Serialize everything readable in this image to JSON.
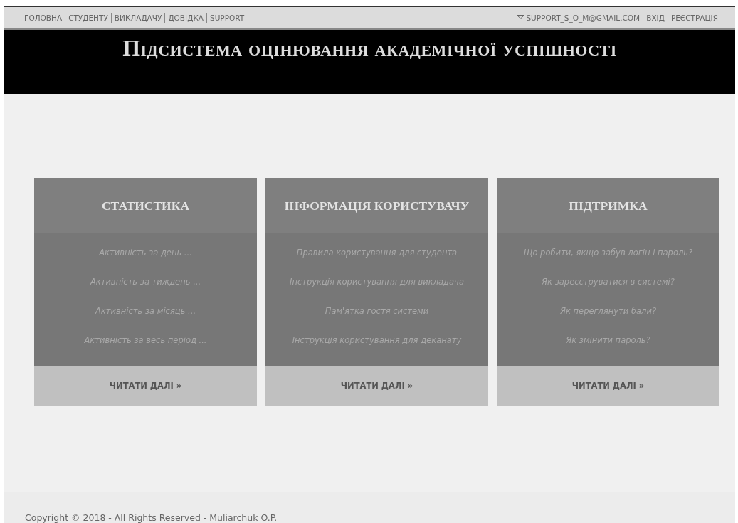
{
  "top_bar": {
    "nav_links": [
      "ГОЛОВНА",
      "СТУДЕНТУ",
      "ВИКЛАДАЧУ",
      "ДОВІДКА",
      "SUPPORT"
    ],
    "email": "SUPPORT_S_O_M@GMAIL.COM",
    "account_links": [
      "ВХІД",
      "РЕЄСТРАЦІЯ"
    ]
  },
  "header": {
    "title": "Підсистема оцінювання академічної успішності"
  },
  "cards": [
    {
      "title": "СТАТИСТИКА",
      "items": [
        "Активність за день ...",
        "Активність за тиждень ...",
        "Активність за місяць ...",
        "Активність за весь період ..."
      ],
      "button": "ЧИТАТИ ДАЛІ »"
    },
    {
      "title": "ІНФОРМАЦІЯ КОРИСТУВАЧУ",
      "items": [
        "Правила користування для студента",
        "Інструкція користування для викладача",
        "Пам'ятка гостя системи",
        "Інструкція користування для деканату"
      ],
      "button": "ЧИТАТИ ДАЛІ »"
    },
    {
      "title": "ПІДТРИМКА",
      "items": [
        "Що робити, якщо забув логін і пароль?",
        "Як зареєструватися в системі?",
        "Як переглянути бали?",
        "Як змінити пароль?"
      ],
      "button": "ЧИТАТИ ДАЛІ »"
    }
  ],
  "footer": {
    "copyright": "Copyright © 2018 - All Rights Reserved - Muliarchuk O.P."
  }
}
